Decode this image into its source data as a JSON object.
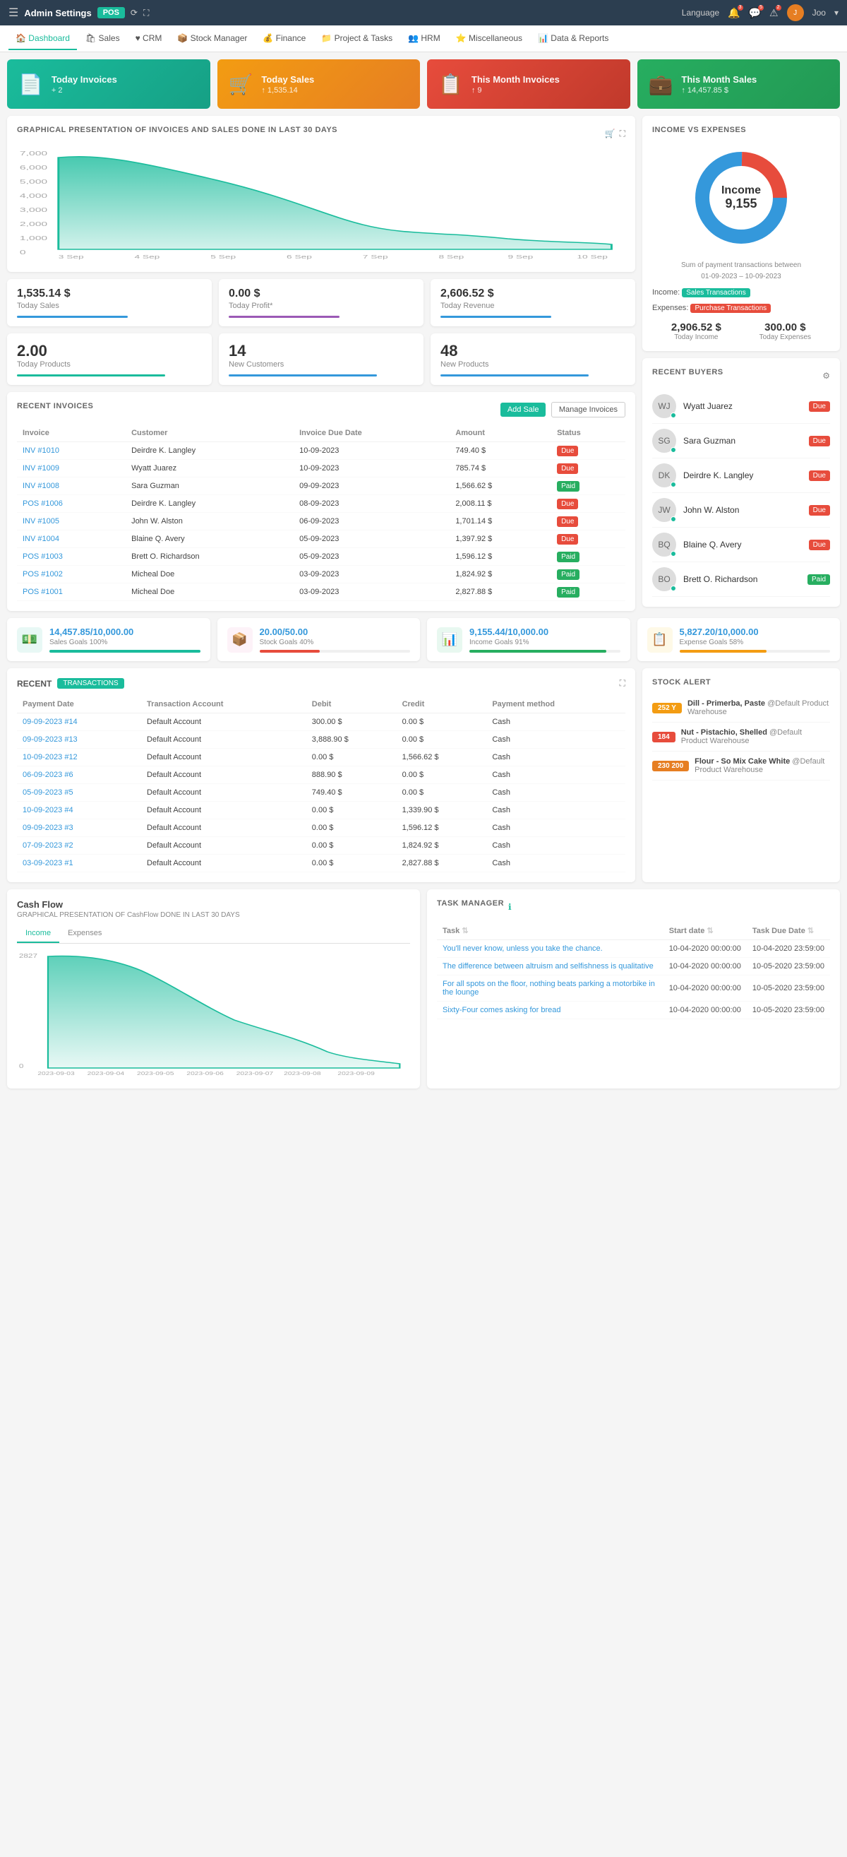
{
  "topNav": {
    "brand": "Admin Settings",
    "posLabel": "POS",
    "languageLabel": "Language",
    "userName": "Joo",
    "icons": [
      "menu-icon",
      "refresh-icon",
      "expand-icon"
    ]
  },
  "secondNav": {
    "items": [
      {
        "label": "Dashboard",
        "icon": "dashboard-icon",
        "active": true
      },
      {
        "label": "Sales",
        "icon": "sales-icon"
      },
      {
        "label": "CRM",
        "icon": "crm-icon"
      },
      {
        "label": "Stock Manager",
        "icon": "stock-icon"
      },
      {
        "label": "Finance",
        "icon": "finance-icon"
      },
      {
        "label": "Project & Tasks",
        "icon": "project-icon"
      },
      {
        "label": "HRM",
        "icon": "hrm-icon"
      },
      {
        "label": "Miscellaneous",
        "icon": "misc-icon"
      },
      {
        "label": "Data & Reports",
        "icon": "reports-icon"
      }
    ]
  },
  "summaryCards": [
    {
      "label": "Today Invoices",
      "value": "+ 2",
      "icon": "📄",
      "color": "teal"
    },
    {
      "label": "Today Sales",
      "value": "↑ 1,535.14",
      "icon": "🛒",
      "color": "orange"
    },
    {
      "label": "This Month Invoices",
      "value": "↑ 9",
      "icon": "📋",
      "color": "pink"
    },
    {
      "label": "This Month Sales",
      "value": "↑ 14,457.85 $",
      "icon": "💼",
      "color": "green"
    }
  ],
  "chartCard": {
    "title": "GRAPHICAL PRESENTATION OF INVOICES AND SALES DONE IN LAST 30 DAYS",
    "dates": [
      "3 Sep",
      "4 Sep",
      "5 Sep",
      "6 Sep",
      "7 Sep",
      "8 Sep",
      "9 Sep",
      "10 Sep"
    ],
    "yLabels": [
      "0",
      "1,000",
      "2,000",
      "3,000",
      "4,000",
      "5,000",
      "6,000",
      "7,000"
    ]
  },
  "statsRow1": [
    {
      "value": "1,535.14 $",
      "label": "Today Sales",
      "barColor": "bar-blue"
    },
    {
      "value": "0.00 $",
      "label": "Today Profit*",
      "barColor": "bar-purple"
    },
    {
      "value": "2,606.52 $",
      "label": "Today Revenue",
      "barColor": "bar-blue"
    }
  ],
  "statsRow2": [
    {
      "value": "2.00",
      "label": "Today Products",
      "barColor": "bar-teal"
    },
    {
      "value": "14",
      "label": "New Customers",
      "barColor": "bar-blue"
    },
    {
      "value": "48",
      "label": "New Products",
      "barColor": "bar-blue"
    }
  ],
  "incomeExpenses": {
    "title": "Income vs Expenses",
    "center": "Income",
    "centerValue": "9,155",
    "dateRange": "01-09-2023 – 10-09-2023",
    "incomeLabel": "Income",
    "incomeTag": "Sales Transactions",
    "expensesLabel": "Expenses",
    "expensesTag": "Purchase Transactions",
    "todayIncome": "2,906.52 $",
    "todayIncomeLabel": "Today Income",
    "todayExpenses": "300.00 $",
    "todayExpensesLabel": "Today Expenses"
  },
  "recentInvoices": {
    "title": "RECENT INVOICES",
    "addSaleBtn": "Add Sale",
    "manageBtn": "Manage Invoices",
    "columns": [
      "Invoice",
      "Customer",
      "Invoice Due Date",
      "Amount",
      "Status"
    ],
    "rows": [
      {
        "inv": "INV #1010",
        "customer": "Deirdre K. Langley",
        "date": "10-09-2023",
        "amount": "749.40 $",
        "status": "Due"
      },
      {
        "inv": "INV #1009",
        "customer": "Wyatt Juarez",
        "date": "10-09-2023",
        "amount": "785.74 $",
        "status": "Due"
      },
      {
        "inv": "INV #1008",
        "customer": "Sara Guzman",
        "date": "09-09-2023",
        "amount": "1,566.62 $",
        "status": "Paid"
      },
      {
        "inv": "POS #1006",
        "customer": "Deirdre K. Langley",
        "date": "08-09-2023",
        "amount": "2,008.11 $",
        "status": "Due"
      },
      {
        "inv": "INV #1005",
        "customer": "John W. Alston",
        "date": "06-09-2023",
        "amount": "1,701.14 $",
        "status": "Due"
      },
      {
        "inv": "INV #1004",
        "customer": "Blaine Q. Avery",
        "date": "05-09-2023",
        "amount": "1,397.92 $",
        "status": "Due"
      },
      {
        "inv": "POS #1003",
        "customer": "Brett O. Richardson",
        "date": "05-09-2023",
        "amount": "1,596.12 $",
        "status": "Paid"
      },
      {
        "inv": "POS #1002",
        "customer": "Micheal Doe",
        "date": "03-09-2023",
        "amount": "1,824.92 $",
        "status": "Paid"
      },
      {
        "inv": "POS #1001",
        "customer": "Micheal Doe",
        "date": "03-09-2023",
        "amount": "2,827.88 $",
        "status": "Paid"
      }
    ]
  },
  "recentBuyers": {
    "title": "RECENT BUYERS",
    "buyers": [
      {
        "name": "Wyatt Juarez",
        "status": "Due",
        "statusColor": "status-due"
      },
      {
        "name": "Sara Guzman",
        "status": "Due",
        "statusColor": "status-due"
      },
      {
        "name": "Deirdre K. Langley",
        "status": "Due",
        "statusColor": "status-due"
      },
      {
        "name": "John W. Alston",
        "status": "Due",
        "statusColor": "status-due"
      },
      {
        "name": "Blaine Q. Avery",
        "status": "Due",
        "statusColor": "status-due"
      },
      {
        "name": "Brett O. Richardson",
        "status": "Paid",
        "statusColor": "status-paid"
      }
    ]
  },
  "goals": [
    {
      "value": "14,457.85/10,000.00",
      "label": "Sales Goals 100%",
      "fill": 100,
      "color": "#1abc9c",
      "icon": "💵",
      "bgClass": "teal-bg"
    },
    {
      "value": "20.00/50.00",
      "label": "Stock Goals 40%",
      "fill": 40,
      "color": "#e74c3c",
      "icon": "📦",
      "bgClass": "pink-bg"
    },
    {
      "value": "9,155.44/10,000.00",
      "label": "Income Goals 91%",
      "fill": 91,
      "color": "#27ae60",
      "icon": "📊",
      "bgClass": "green-bg"
    },
    {
      "value": "5,827.20/10,000.00",
      "label": "Expense Goals 58%",
      "fill": 58,
      "color": "#f39c12",
      "icon": "📋",
      "bgClass": "orange-bg"
    }
  ],
  "transactions": {
    "title": "RECENT",
    "badge": "TRANSACTIONS",
    "columns": [
      "Payment Date",
      "Transaction Account",
      "Debit",
      "Credit",
      "Payment method"
    ],
    "rows": [
      {
        "date": "09-09-2023 #14",
        "account": "Default Account",
        "debit": "300.00 $",
        "credit": "0.00 $",
        "method": "Cash"
      },
      {
        "date": "09-09-2023 #13",
        "account": "Default Account",
        "debit": "3,888.90 $",
        "credit": "0.00 $",
        "method": "Cash"
      },
      {
        "date": "10-09-2023 #12",
        "account": "Default Account",
        "debit": "0.00 $",
        "credit": "1,566.62 $",
        "method": "Cash"
      },
      {
        "date": "06-09-2023 #6",
        "account": "Default Account",
        "debit": "888.90 $",
        "credit": "0.00 $",
        "method": "Cash"
      },
      {
        "date": "05-09-2023 #5",
        "account": "Default Account",
        "debit": "749.40 $",
        "credit": "0.00 $",
        "method": "Cash"
      },
      {
        "date": "10-09-2023 #4",
        "account": "Default Account",
        "debit": "0.00 $",
        "credit": "1,339.90 $",
        "method": "Cash"
      },
      {
        "date": "09-09-2023 #3",
        "account": "Default Account",
        "debit": "0.00 $",
        "credit": "1,596.12 $",
        "method": "Cash"
      },
      {
        "date": "07-09-2023 #2",
        "account": "Default Account",
        "debit": "0.00 $",
        "credit": "1,824.92 $",
        "method": "Cash"
      },
      {
        "date": "03-09-2023 #1",
        "account": "Default Account",
        "debit": "0.00 $",
        "credit": "2,827.88 $",
        "method": "Cash"
      }
    ]
  },
  "stockAlert": {
    "title": "STOCK ALERT",
    "items": [
      {
        "qty": "252 Y",
        "name": "Dill - Primerba, Paste",
        "location": "@Default Product Warehouse",
        "color": "yellow"
      },
      {
        "qty": "184",
        "name": "Nut - Pistachio, Shelled",
        "location": "@Default Product Warehouse",
        "color": "red"
      },
      {
        "qty": "230 200",
        "name": "Flour - So Mix Cake White",
        "location": "@Default Product Warehouse",
        "color": "orange"
      }
    ]
  },
  "cashFlow": {
    "title": "Cash Flow",
    "subtitle": "GRAPHICAL PRESENTATION OF CashFlow DONE IN LAST 30 DAYS",
    "tabs": [
      "Income",
      "Expenses"
    ],
    "activeTab": "Income",
    "xLabels": [
      "2023-09-03",
      "2023-09-04",
      "2023-09-05",
      "2023-09-06",
      "2023-09-07",
      "2023-09-08",
      "2023-09-09"
    ],
    "yMax": "2827"
  },
  "taskManager": {
    "title": "TASK MANAGER",
    "columns": [
      "Task",
      "Start date",
      "Task Due Date"
    ],
    "rows": [
      {
        "task": "You'll never know, unless you take the chance.",
        "start": "10-04-2020 00:00:00",
        "due": "10-04-2020 23:59:00"
      },
      {
        "task": "The difference between altruism and selfishness is qualitative",
        "start": "10-04-2020 00:00:00",
        "due": "10-05-2020 23:59:00"
      },
      {
        "task": "For all spots on the floor, nothing beats parking a motorbike in the lounge",
        "start": "10-04-2020 00:00:00",
        "due": "10-05-2020 23:59:00"
      },
      {
        "task": "Sixty-Four comes asking for bread",
        "start": "10-04-2020 00:00:00",
        "due": "10-05-2020 23:59:00"
      }
    ]
  }
}
